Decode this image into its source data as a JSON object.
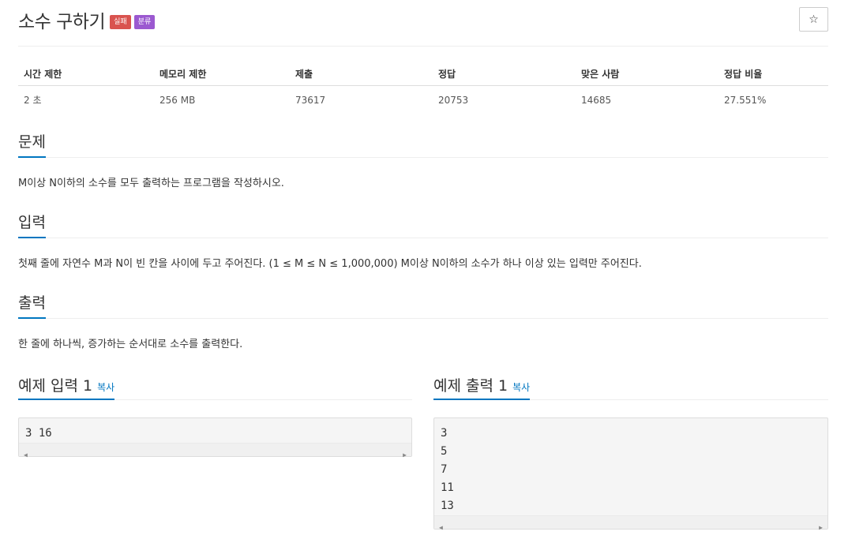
{
  "title": "소수 구하기",
  "badges": [
    {
      "label": "실패",
      "color": "#d9534f"
    },
    {
      "label": "분류",
      "color": "#9b59d0"
    }
  ],
  "star": "☆",
  "info": {
    "headers": [
      "시간 제한",
      "메모리 제한",
      "제출",
      "정답",
      "맞은 사람",
      "정답 비율"
    ],
    "values": [
      "2 초",
      "256 MB",
      "73617",
      "20753",
      "14685",
      "27.551%"
    ]
  },
  "problem": {
    "title": "문제",
    "body": "M이상 N이하의 소수를 모두 출력하는 프로그램을 작성하시오."
  },
  "input": {
    "title": "입력",
    "body": "첫째 줄에 자연수 M과 N이 빈 칸을 사이에 두고 주어진다. (1 ≤ M ≤ N ≤ 1,000,000) M이상 N이하의 소수가 하나 이상 있는 입력만 주어진다."
  },
  "output": {
    "title": "출력",
    "body": "한 줄에 하나씩, 증가하는 순서대로 소수를 출력한다."
  },
  "sample_input": {
    "title": "예제 입력 1",
    "copy": "복사",
    "lines": [
      "3 16"
    ]
  },
  "sample_output": {
    "title": "예제 출력 1",
    "copy": "복사",
    "lines": [
      "3",
      "5",
      "7",
      "11",
      "13"
    ]
  },
  "colors": {
    "accent": "#0076c0"
  }
}
